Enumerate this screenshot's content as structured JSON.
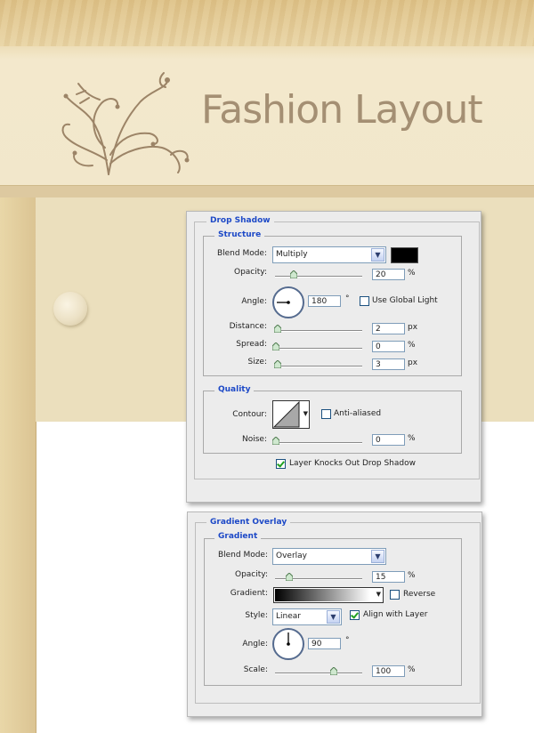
{
  "header": {
    "title": "Fashion Layout"
  },
  "drop_shadow": {
    "title": "Drop Shadow",
    "structure": {
      "title": "Structure",
      "blend_mode_label": "Blend Mode:",
      "blend_mode": "Multiply",
      "color": "#000000",
      "opacity_label": "Opacity:",
      "opacity": "20",
      "opacity_unit": "%",
      "opacity_level": 0.2,
      "angle_label": "Angle:",
      "angle": "180",
      "angle_unit": "°",
      "global_light_label": "Use Global Light",
      "global_light": false,
      "distance_label": "Distance:",
      "distance": "2",
      "distance_unit": "px",
      "distance_level": 0.02,
      "spread_label": "Spread:",
      "spread": "0",
      "spread_unit": "%",
      "spread_level": 0.0,
      "size_label": "Size:",
      "size": "3",
      "size_unit": "px",
      "size_level": 0.02
    },
    "quality": {
      "title": "Quality",
      "contour_label": "Contour:",
      "anti_aliased_label": "Anti-aliased",
      "anti_aliased": false,
      "noise_label": "Noise:",
      "noise": "0",
      "noise_unit": "%",
      "noise_level": 0.0
    },
    "knockout_label": "Layer Knocks Out Drop Shadow",
    "knockout": true
  },
  "gradient_overlay": {
    "title": "Gradient Overlay",
    "gradient": {
      "title": "Gradient",
      "blend_mode_label": "Blend Mode:",
      "blend_mode": "Overlay",
      "opacity_label": "Opacity:",
      "opacity": "15",
      "opacity_unit": "%",
      "opacity_level": 0.15,
      "gradient_label": "Gradient:",
      "reverse_label": "Reverse",
      "reverse": false,
      "style_label": "Style:",
      "style": "Linear",
      "align_label": "Align with Layer",
      "align": true,
      "angle_label": "Angle:",
      "angle": "90",
      "angle_unit": "°",
      "scale_label": "Scale:",
      "scale": "100",
      "scale_unit": "%",
      "scale_level": 0.667
    }
  }
}
